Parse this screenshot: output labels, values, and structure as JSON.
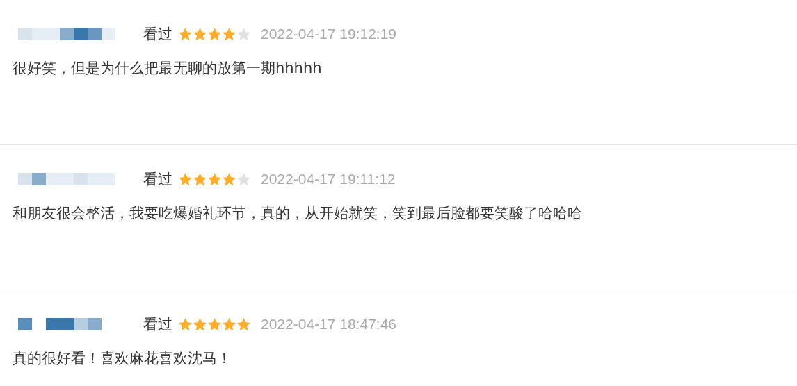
{
  "reviews": [
    {
      "status": "看过",
      "stars": 4,
      "time": "2022-04-17 19:12:19",
      "text": "很好笑，但是为什么把最无聊的放第一期hhhhh"
    },
    {
      "status": "看过",
      "stars": 4,
      "time": "2022-04-17 19:11:12",
      "text": "和朋友很会整活，我要吃爆婚礼环节，真的，从开始就笑，笑到最后脸都要笑酸了哈哈哈"
    },
    {
      "status": "看过",
      "stars": 5,
      "time": "2022-04-17 18:47:46",
      "text": "真的很好看！喜欢麻花喜欢沈马！"
    }
  ]
}
